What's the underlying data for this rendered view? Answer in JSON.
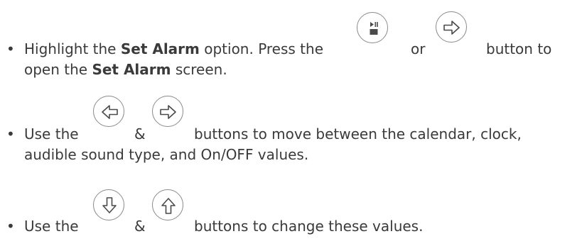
{
  "items": [
    {
      "bullet": "•",
      "line1_prefix": "Highlight the ",
      "line1_bold1": "Set Alarm",
      "line1_mid": " option. Press the",
      "joiner": "or",
      "line1_suffix": "button to",
      "line2_prefix": "open the ",
      "line2_bold": "Set Alarm",
      "line2_suffix": " screen.",
      "icons": [
        "play-pause-stop-icon",
        "arrow-right-icon"
      ]
    },
    {
      "bullet": "•",
      "line1_prefix": "Use the",
      "joiner": "&",
      "line1_suffix": "buttons to move between the calendar, clock,",
      "line2": "audible sound type, and On/OFF values.",
      "icons": [
        "arrow-left-icon",
        "arrow-right-icon"
      ]
    },
    {
      "bullet": "•",
      "line1_prefix": "Use the",
      "joiner": "&",
      "line1_suffix": "buttons to change these values.",
      "icons": [
        "arrow-down-icon",
        "arrow-up-icon"
      ]
    }
  ],
  "colors": {
    "text": "#3a3a3a",
    "icon_stroke": "#8a8a8a"
  }
}
